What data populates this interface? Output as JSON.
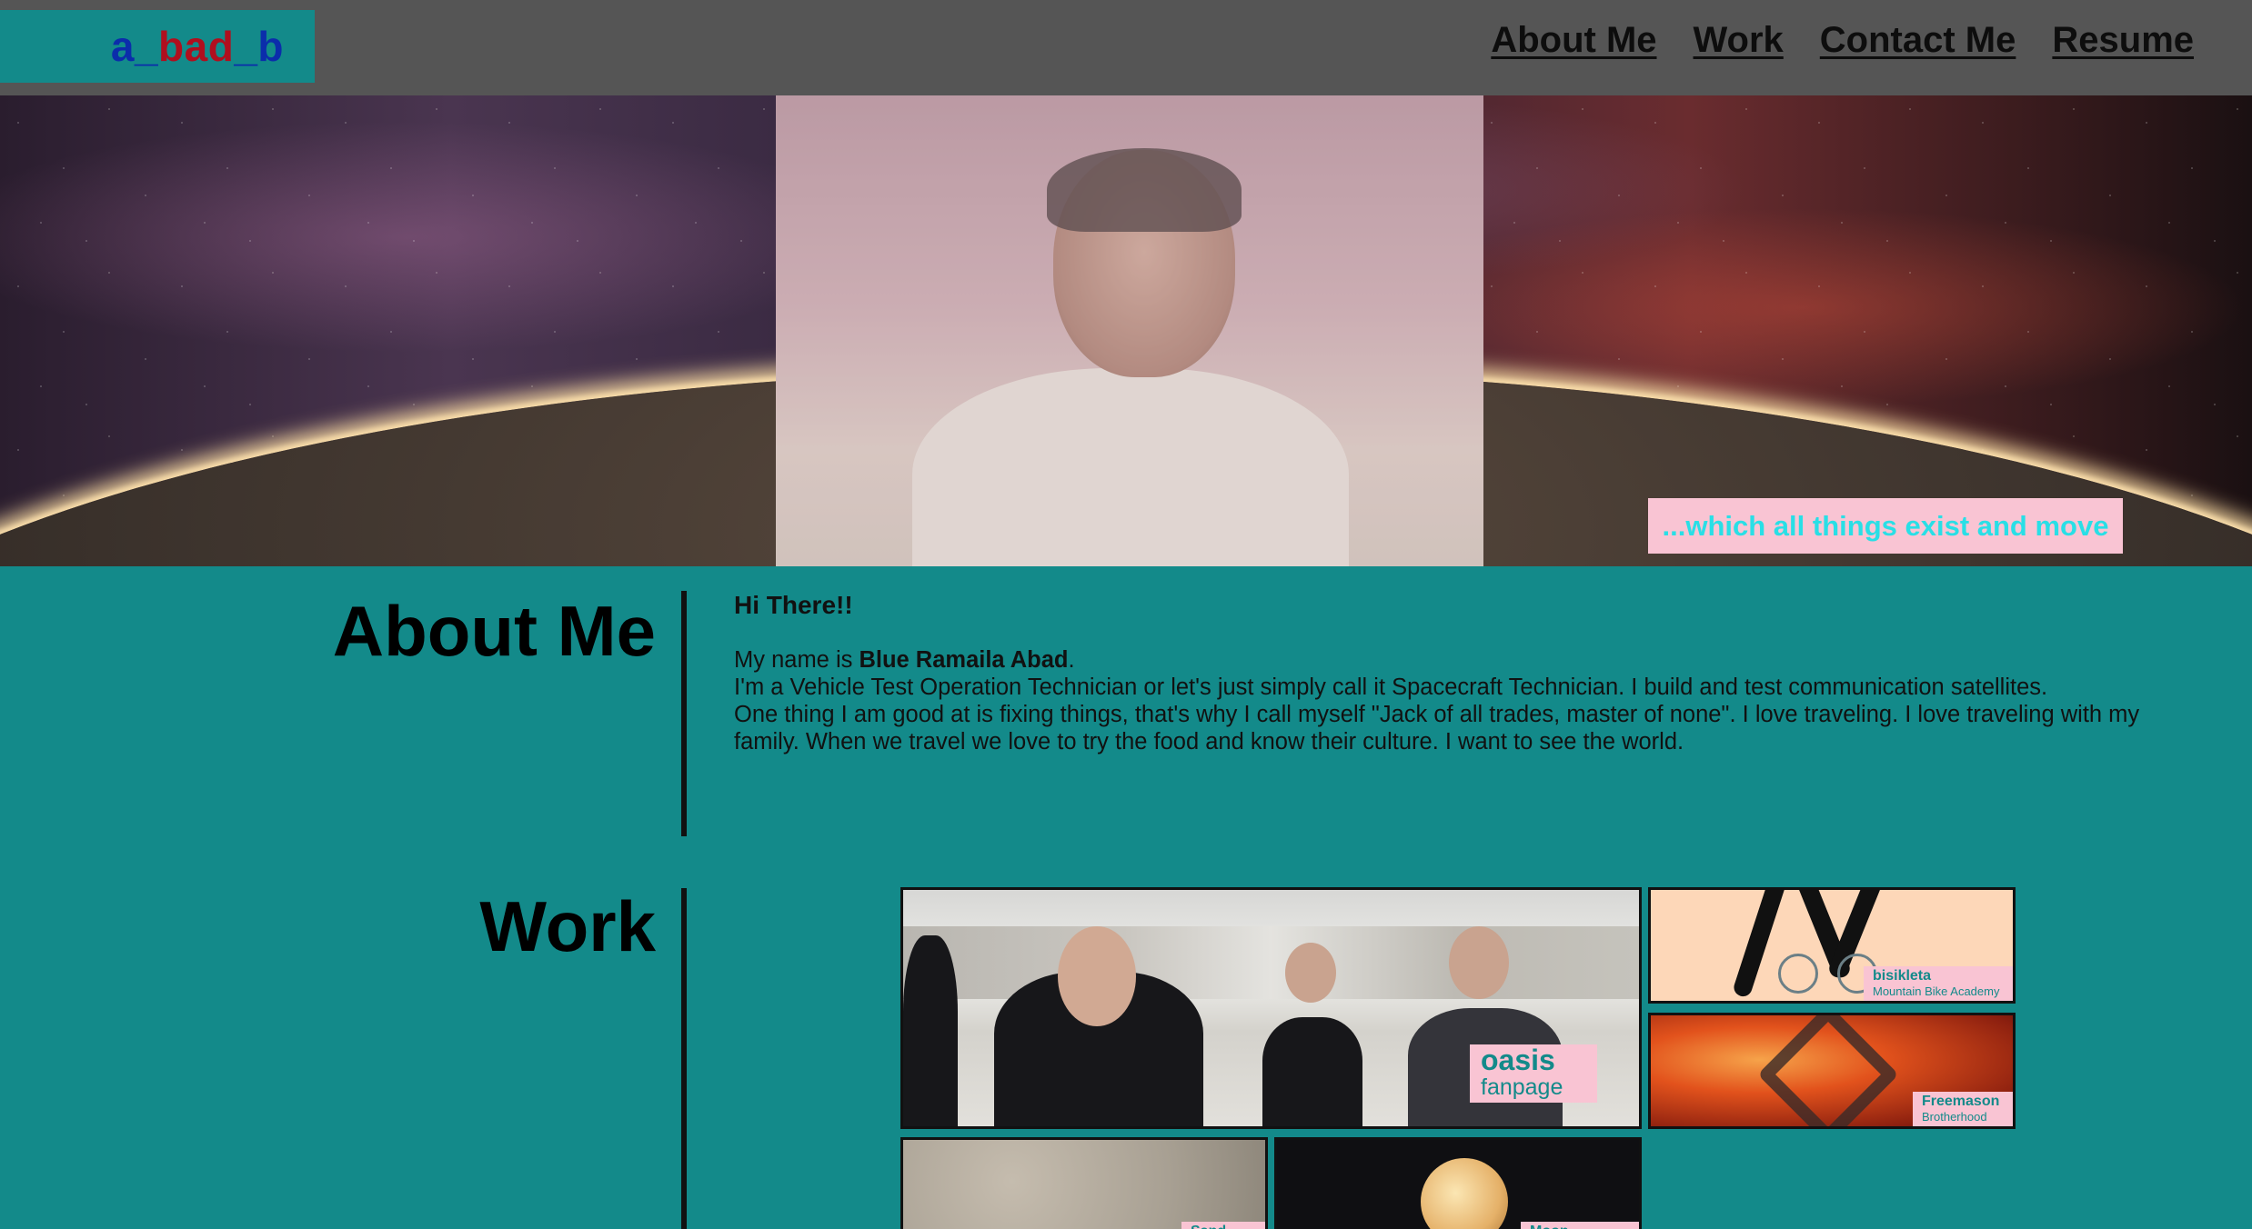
{
  "header": {
    "logo": {
      "part1": "a_",
      "part2": "bad",
      "part3": "_b"
    },
    "nav": [
      "About Me",
      "Work",
      "Contact Me",
      "Resume"
    ]
  },
  "hero": {
    "tagline": "...which all things exist and move"
  },
  "about": {
    "title": "About Me",
    "greeting": "Hi There!!",
    "name_prefix": "My name is ",
    "name": "Blue Ramaila Abad",
    "name_suffix": ".",
    "line2": "I'm a Vehicle Test Operation Technician or let's just simply call it Spacecraft Technician. I build and test communication satellites.",
    "line3": "One thing I am good at is fixing things, that's why I call myself \"Jack of all trades, master of none\". I love traveling. I love traveling with my family. When we travel we love to try the food and know their culture. I want to see the world."
  },
  "work": {
    "title": "Work",
    "projects": [
      {
        "title": "oasis",
        "subtitle": "fanpage"
      },
      {
        "title": "bisikleta",
        "subtitle": "Mountain Bike Academy"
      },
      {
        "title": "Freemason",
        "subtitle": "Brotherhood"
      },
      {
        "title": "Sand",
        "subtitle": ""
      },
      {
        "title": "Moon",
        "subtitle": ""
      }
    ]
  },
  "colors": {
    "page_bg": "#138a8a",
    "header_bg": "#555555",
    "label_bg": "#f9c4d3",
    "tagline_text": "#29dfe6",
    "logo_blue": "#0b2dab",
    "logo_red": "#b00f1e"
  }
}
